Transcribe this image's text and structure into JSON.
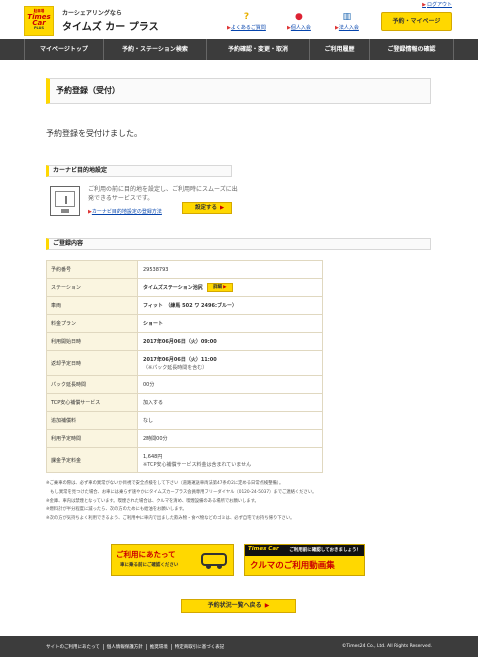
{
  "header": {
    "logout": "ログアウト",
    "logo": {
      "line1": "駐車場",
      "line2a": "Times",
      "line2b": "Car",
      "line3": "PLUS"
    },
    "brand_sub": "カーシェアリングなら",
    "brand_main": "タイムズ カー プラス",
    "faq": "よくあるご質問",
    "join_person": "個人入会",
    "join_corp": "法人入会",
    "mypage_button": "予約・マイページ"
  },
  "nav": {
    "items": [
      "マイページトップ",
      "予約・ステーション検索",
      "予約確認・変更・取消",
      "ご利用履歴",
      "ご登録情報の確認"
    ]
  },
  "page": {
    "title": "予約登録（受付）",
    "message": "予約登録を受付けました。"
  },
  "carnavi": {
    "heading": "カーナビ目的地設定",
    "desc": "ご利用の前に目的地を設定し、ご利用時にスムーズに出発できるサービスです。",
    "link": "カーナビ目的地設定の登録方法",
    "button": "設定する"
  },
  "registration": {
    "heading": "ご登録内容",
    "rows": [
      {
        "label": "予約番号",
        "value": "29538793"
      },
      {
        "label": "ステーション",
        "value": "タイムズステーション池尻",
        "button": "詳細"
      },
      {
        "label": "車両",
        "value": "フィット　（練馬 502 ワ 2496:ブルー）"
      },
      {
        "label": "料金プラン",
        "value": "ショート"
      },
      {
        "label": "利用開始日時",
        "value": "2017年06月06日（火）09:00"
      },
      {
        "label": "返却予定日時",
        "value": "2017年06月06日（火）11:00",
        "sub": "（※パック延長時間を含む）"
      },
      {
        "label": "パック延長時間",
        "value": "00分"
      },
      {
        "label": "TCP安心補償サービス",
        "value": "加入する"
      },
      {
        "label": "追加補償料",
        "value": "なし"
      },
      {
        "label": "利用予定時間",
        "value": "2時間00分"
      },
      {
        "label": "課金予定料金",
        "value": "1,648円",
        "sub": "※TCP安心補償サービス料金は含まれていません"
      }
    ]
  },
  "notes": [
    "※ご乗車の際は、必ず車の異常がないか目視で安全点検をして下さい（道路運送車両法第47条の2に定める日常点検整備）。",
    "　もし異常を見つけた場合、お車には乗らず速やかにタイムズカープラス会員専用フリーダイヤル（0120-24-5037）までご連絡ください。",
    "※金庫、車内は禁煙となっています。喫煙された場合は、クルマを清め、喫煙設備のある場所でお願いします。",
    "※燃料計が半分程度に減ったら、次の方のためにも給油をお願いします。",
    "※次の方が気持ちよく利用できるよう、ご利用中に車内で出ました飲み物・食べ物などのゴミは、必ず自宅でお持ち帰り下さい。"
  ],
  "banners": {
    "b1_title": "ご利用にあたって",
    "b1_sub": "車に乗る前にご確認ください",
    "b2_logo": "Times Car",
    "b2_top": "ご利用前に確認しておきましょう！",
    "b2_main": "クルマのご利用動画集"
  },
  "back_button": "予約状況一覧へ戻る",
  "footer": {
    "links": [
      "サイトのご利用にあたって",
      "個人情報保護方針",
      "推奨環境",
      "特定商取引に基づく表記"
    ],
    "copyright": "©Times24 Co., Ltd. All Rights Reserved."
  }
}
